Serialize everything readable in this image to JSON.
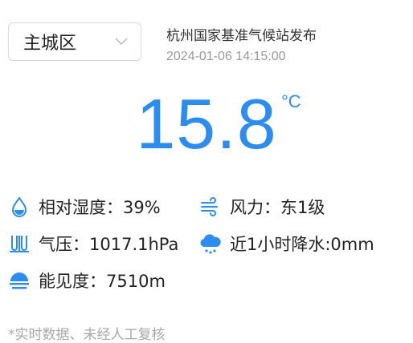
{
  "region": {
    "selected": "主城区"
  },
  "source": "杭州国家基准气候站发布",
  "timestamp": "2024-01-06 14:15:00",
  "temperature": {
    "value": "15.8",
    "unit": "°C"
  },
  "details": {
    "humidity": "相对湿度：39%",
    "wind": "风力：东1级",
    "pressure": "气压：1017.1hPa",
    "rain": "近1小时降水:0mm",
    "visibility": "能见度：7510m"
  },
  "note": "*实时数据、未经人工复核",
  "icons": {
    "humidity": "water-drop-icon",
    "wind": "wind-icon",
    "pressure": "pressure-icon",
    "rain": "rain-cloud-icon",
    "visibility": "sun-horizon-icon"
  },
  "colors": {
    "accent": "#2d8cf0",
    "muted": "#999999"
  }
}
